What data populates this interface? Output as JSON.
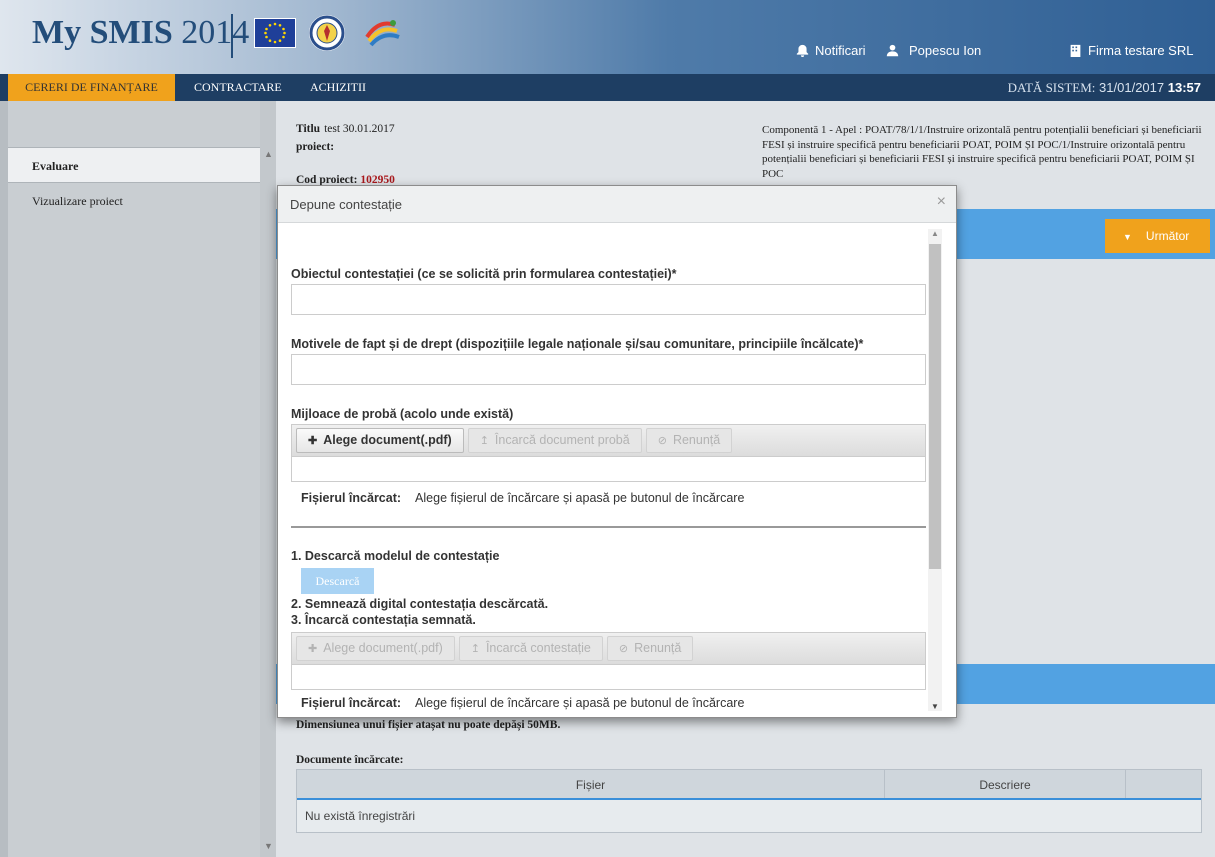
{
  "header": {
    "brand_bold": "My SMIS",
    "brand_year": "2014",
    "notif_label": "Notificari",
    "user_name": "Popescu Ion",
    "firm_name": "Firma testare SRL",
    "eu_flag_icon": "eu-flag-icon",
    "seal_icon": "romania-seal-icon"
  },
  "nav": {
    "items": [
      "CERERI DE FINANȚARE",
      "CONTRACTARE",
      "ACHIZITII"
    ],
    "sys_date_label": "DATĂ SISTEM:",
    "sys_date": "31/01/2017",
    "sys_time": "13:57",
    "active_color": "#f0a21c"
  },
  "sidebar": {
    "items": [
      "Evaluare",
      "Vizualizare proiect"
    ]
  },
  "project": {
    "title_label": "Titlu",
    "title_value": "test 30.01.2017",
    "title_label2": "proiect:",
    "code_label": "Cod proiect:",
    "code_value": "102950",
    "component_text": "Componentă 1 - Apel : POAT/78/1/1/Instruire orizontală pentru potențialii beneficiari și beneficiarii FESI și instruire specifică pentru beneficiarii POAT, POIM ȘI POC/1/Instruire orizontală pentru potențialii beneficiari și beneficiarii FESI și instruire specifică pentru beneficiarii POAT, POIM ȘI POC",
    "next_label": "Următor"
  },
  "documents": {
    "size_note": "Dimensiunea unui fișier atașat nu poate depăși 50MB.",
    "section_label": "Documente încărcate:",
    "columns": [
      "Fișier",
      "Descriere",
      ""
    ],
    "empty_text": "Nu există înregistrări"
  },
  "modal": {
    "title": "Depune contestație",
    "field1_label": "Obiectul contestației (ce se solicită prin formularea contestației)*",
    "field1_value": "",
    "field2_label": "Motivele de fapt și de drept (dispozițiile legale naționale și/sau comunitare, principiile încălcate)*",
    "field2_value": "",
    "proof_label": "Mijloace de probă (acolo unde există)",
    "upload1": {
      "choose": "Alege document(.pdf)",
      "upload": "Încarcă document probă",
      "cancel": "Renunță"
    },
    "file_label": "Fișierul încărcat:",
    "file_hint": "Alege fișierul de încărcare și apasă pe butonul de încărcare",
    "step1": "1. Descarcă modelul de contestație",
    "download_label": "Descarcă",
    "step2": "2. Semnează digital contestația descărcată.",
    "step3": "3. Încarcă contestația semnată.",
    "upload2": {
      "choose": "Alege document(.pdf)",
      "upload": "Încarcă contestație",
      "cancel": "Renunță"
    }
  }
}
